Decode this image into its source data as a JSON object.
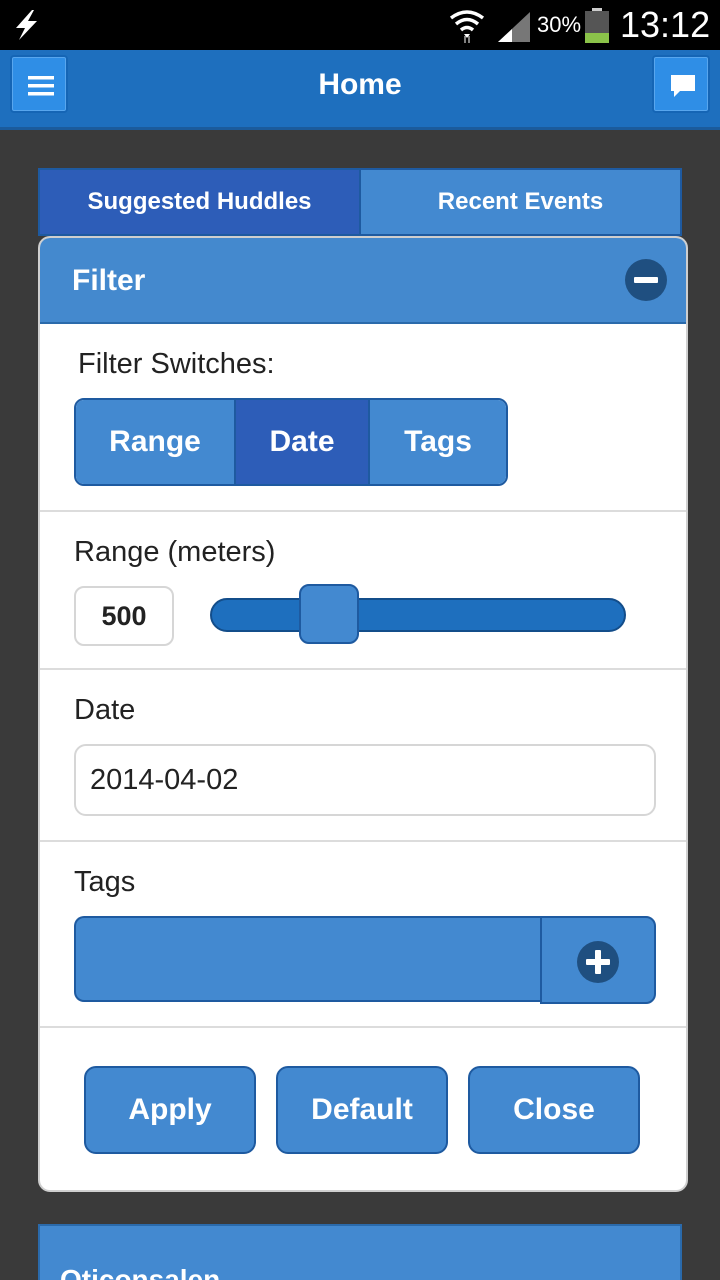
{
  "status_bar": {
    "battery_percent": "30%",
    "time": "13:12"
  },
  "header": {
    "title": "Home",
    "menu_icon": "menu-icon",
    "chat_icon": "chat-icon"
  },
  "tabs": [
    {
      "label": "Suggested Huddles",
      "active": true
    },
    {
      "label": "Recent Events",
      "active": false
    }
  ],
  "filter": {
    "title": "Filter",
    "collapse_icon": "minus-circle-icon",
    "switches_label": "Filter Switches:",
    "switches": [
      {
        "label": "Range",
        "active": false
      },
      {
        "label": "Date",
        "active": true
      },
      {
        "label": "Tags",
        "active": false
      }
    ],
    "range": {
      "label": "Range (meters)",
      "value": "500",
      "slider_fraction": 0.25
    },
    "date": {
      "label": "Date",
      "value": "2014-04-02"
    },
    "tags": {
      "label": "Tags",
      "value": "",
      "add_icon": "plus-circle-icon"
    },
    "buttons": {
      "apply": "Apply",
      "default": "Default",
      "close": "Close"
    }
  },
  "list": {
    "first_item": "Oticonsalen"
  },
  "colors": {
    "header_blue": "#1e6fbe",
    "button_blue": "#4389d0",
    "active_blue": "#2d5db8",
    "background": "#3a3a3a"
  }
}
